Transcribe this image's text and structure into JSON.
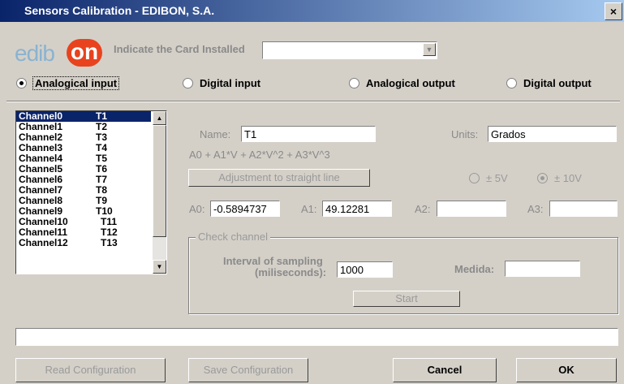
{
  "window": {
    "title": "Sensors Calibration - EDIBON, S.A.",
    "close_label": "×"
  },
  "logo": {
    "part1": "edib",
    "part2": "on"
  },
  "card": {
    "label": "Indicate the Card Installed",
    "value": ""
  },
  "io_modes": {
    "analog_in": "Analogical input",
    "digital_in": "Digital input",
    "analog_out": "Analogical output",
    "digital_out": "Digital output",
    "selected": "analog_in"
  },
  "channels": [
    {
      "ch": "Channel0",
      "t": "T1"
    },
    {
      "ch": "Channel1",
      "t": "T2"
    },
    {
      "ch": "Channel2",
      "t": "T3"
    },
    {
      "ch": "Channel3",
      "t": "T4"
    },
    {
      "ch": "Channel4",
      "t": "T5"
    },
    {
      "ch": "Channel5",
      "t": "T6"
    },
    {
      "ch": "Channel6",
      "t": "T7"
    },
    {
      "ch": "Channel7",
      "t": "T8"
    },
    {
      "ch": "Channel8",
      "t": "T9"
    },
    {
      "ch": "Channel9",
      "t": "T10"
    },
    {
      "ch": "Channel10",
      "t": "T11"
    },
    {
      "ch": "Channel11",
      "t": "T12"
    },
    {
      "ch": "Channel12",
      "t": "T13"
    }
  ],
  "form": {
    "name_label": "Name:",
    "name_value": "T1",
    "units_label": "Units:",
    "units_value": "Grados",
    "formula": "A0 + A1*V + A2*V^2 + A3*V^3",
    "adjust_button": "Adjustment to straight line",
    "range_5v": "± 5V",
    "range_10v": "± 10V",
    "range_selected": "10V",
    "a0_label": "A0:",
    "a0_value": "-0.5894737",
    "a1_label": "A1:",
    "a1_value": "49.12281",
    "a2_label": "A2:",
    "a2_value": "",
    "a3_label": "A3:",
    "a3_value": ""
  },
  "check": {
    "legend": "Check channel",
    "interval_label_1": "Interval of sampling",
    "interval_label_2": "(miliseconds):",
    "interval_value": "1000",
    "medida_label": "Medida:",
    "medida_value": "",
    "start_button": "Start"
  },
  "status_text": "",
  "footer": {
    "read_config": "Read Configuration",
    "save_config": "Save Configuration",
    "cancel": "Cancel",
    "ok": "OK"
  }
}
